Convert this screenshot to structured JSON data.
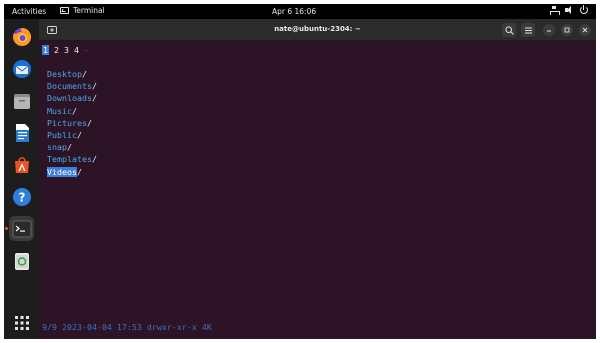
{
  "topbar": {
    "activities": "Activities",
    "app_name": "Terminal",
    "clock": "Apr 6  16:06"
  },
  "window": {
    "title": "nate@ubuntu-2304: ~"
  },
  "dock": {
    "items": [
      "firefox-icon",
      "thunderbird-icon",
      "files-icon",
      "libreoffice-writer-icon",
      "app-center-icon",
      "help-icon",
      "terminal-icon",
      "trash-icon",
      "show-apps-icon"
    ]
  },
  "terminal": {
    "tabs": [
      "1",
      "2",
      "3",
      "4"
    ],
    "tab_separator": "–",
    "directories": [
      {
        "name": "Desktop",
        "suffix": "/"
      },
      {
        "name": "Documents",
        "suffix": "/"
      },
      {
        "name": "Downloads",
        "suffix": "/"
      },
      {
        "name": "Music",
        "suffix": "/"
      },
      {
        "name": "Pictures",
        "suffix": "/"
      },
      {
        "name": "Public",
        "suffix": "/"
      },
      {
        "name": "snap",
        "suffix": "/"
      },
      {
        "name": "Templates",
        "suffix": "/"
      },
      {
        "name": "Videos",
        "suffix": "/"
      }
    ],
    "selected_index": 8,
    "status_line": "9/9 2023-04-04 17:53 drwxr-xr-x 4K"
  },
  "colors": {
    "terminal_bg": "#2c1325",
    "dir_color": "#4aa8e8",
    "selection": "#3b7fd6",
    "ubuntu_orange": "#e95420"
  }
}
